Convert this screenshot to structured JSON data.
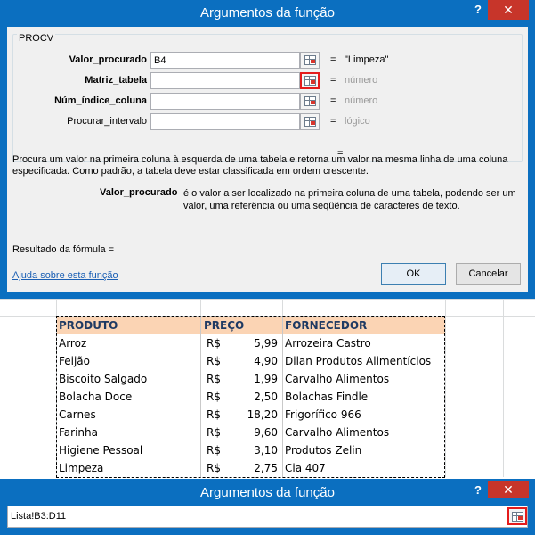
{
  "dialog": {
    "title": "Argumentos da função",
    "help_glyph": "?",
    "close_glyph": "✕",
    "function_name": "PROCV",
    "args": [
      {
        "label": "Valor_procurado",
        "bold": true,
        "value": "B4",
        "eq": "=",
        "result": "\"Limpeza\"",
        "muted": false
      },
      {
        "label": "Matriz_tabela",
        "bold": true,
        "value": "",
        "eq": "=",
        "result": "número",
        "muted": true
      },
      {
        "label": "Núm_índice_coluna",
        "bold": true,
        "value": "",
        "eq": "=",
        "result": "número",
        "muted": true
      },
      {
        "label": "Procurar_intervalo",
        "bold": false,
        "value": "",
        "eq": "=",
        "result": "lógico",
        "muted": true
      }
    ],
    "equals_only": "=",
    "description": "Procura um valor na primeira coluna à esquerda de uma tabela e retorna um valor na mesma linha de uma coluna especificada. Como padrão, a tabela deve estar classificada em ordem crescente.",
    "param_name": "Valor_procurado",
    "param_description": "é o valor a ser localizado na primeira coluna de uma tabela, podendo ser um valor, uma referência ou uma seqüência de caracteres de texto.",
    "formula_result": "Resultado da fórmula =",
    "help_link": "Ajuda sobre esta função",
    "ok_label": "OK",
    "cancel_label": "Cancelar"
  },
  "sheet": {
    "headers": [
      "PRODUTO",
      "PREÇO",
      "FORNECEDOR"
    ],
    "rows": [
      {
        "produto": "Arroz",
        "moeda": "R$",
        "preco": "5,99",
        "fornecedor": "Arrozeira Castro"
      },
      {
        "produto": "Feijão",
        "moeda": "R$",
        "preco": "4,90",
        "fornecedor": "Dilan Produtos Alimentícios"
      },
      {
        "produto": "Biscoito Salgado",
        "moeda": "R$",
        "preco": "1,99",
        "fornecedor": "Carvalho Alimentos"
      },
      {
        "produto": "Bolacha Doce",
        "moeda": "R$",
        "preco": "2,50",
        "fornecedor": "Bolachas Findle"
      },
      {
        "produto": "Carnes",
        "moeda": "R$",
        "preco": "18,20",
        "fornecedor": "Frigorífico 966"
      },
      {
        "produto": "Farinha",
        "moeda": "R$",
        "preco": "9,60",
        "fornecedor": "Carvalho Alimentos"
      },
      {
        "produto": "Higiene Pessoal",
        "moeda": "R$",
        "preco": "3,10",
        "fornecedor": "Produtos Zelin"
      },
      {
        "produto": "Limpeza",
        "moeda": "R$",
        "preco": "2,75",
        "fornecedor": "Cia 407"
      }
    ],
    "colors": {
      "header_fill": "#fbd4b4",
      "header_text": "#1f3a63"
    }
  },
  "collapsed_dialog": {
    "title": "Argumentos da função",
    "help_glyph": "?",
    "close_glyph": "✕",
    "range_value": "Lista!B3:D11"
  },
  "icons": [
    "range-selector-icon",
    "help-icon",
    "close-icon"
  ],
  "colors": {
    "titlebar": "#0b6fc0",
    "close": "#c7352a",
    "highlight": "#e41b1b"
  }
}
